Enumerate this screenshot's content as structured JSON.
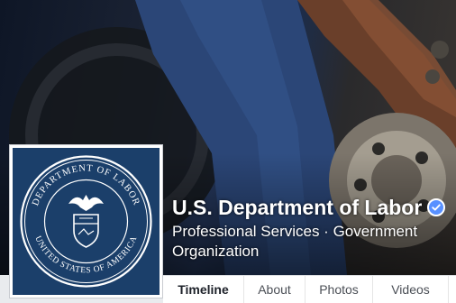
{
  "page": {
    "name": "U.S. Department of Labor",
    "category": "Professional Services · Government Organization",
    "verified": true
  },
  "profile_picture": {
    "icon": "department-of-labor-seal",
    "seal_text_top": "DEPARTMENT OF LABOR",
    "seal_text_bottom": "UNITED STATES OF AMERICA",
    "background_color": "#1b3f6a"
  },
  "cover_photo": {
    "description_icon": "worker-changing-tire-photo"
  },
  "tabs": [
    {
      "label": "Timeline",
      "active": true
    },
    {
      "label": "About",
      "active": false
    },
    {
      "label": "Photos",
      "active": false
    },
    {
      "label": "Videos",
      "active": false
    }
  ],
  "colors": {
    "verified_badge": "#5890ff",
    "tab_text": "#4b4f56"
  }
}
